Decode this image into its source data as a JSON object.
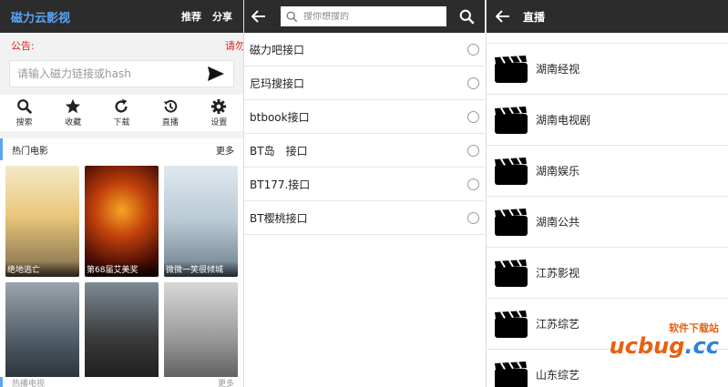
{
  "left": {
    "app_title": "磁力云影视",
    "actions": [
      "推荐",
      "分享"
    ],
    "notice_label": "公告:",
    "notice_text": "请勿",
    "magnet_placeholder": "请输入磁力链接或hash",
    "quick": [
      {
        "label": "搜索",
        "icon": "search-icon"
      },
      {
        "label": "收藏",
        "icon": "star-icon"
      },
      {
        "label": "下载",
        "icon": "refresh-icon"
      },
      {
        "label": "直播",
        "icon": "history-icon"
      },
      {
        "label": "设置",
        "icon": "gear-icon"
      }
    ],
    "hot_title": "热门电影",
    "more": "更多",
    "posters": [
      {
        "caption": "绝地逃亡"
      },
      {
        "caption": "第68届艾美奖"
      },
      {
        "caption": "微微一笑很倾城"
      },
      {
        "caption": ""
      },
      {
        "caption": ""
      },
      {
        "caption": ""
      }
    ],
    "next_section": "热播电视",
    "next_more": "更多"
  },
  "middle": {
    "search_placeholder": "搜你想搜的",
    "apis": [
      "磁力吧接口",
      "尼玛搜接口",
      "btbook接口",
      "BT岛　接口",
      "BT177.接口",
      "BT樱桃接口"
    ]
  },
  "right": {
    "title": "直播",
    "channels": [
      "湖南经视",
      "湖南电视剧",
      "湖南娱乐",
      "湖南公共",
      "江苏影视",
      "江苏综艺",
      "山东综艺"
    ],
    "watermark_cn": "软件下载站",
    "watermark_brand_a": "ucbug",
    "watermark_brand_b": ".cc"
  },
  "colors": {
    "accent": "#5ba4f5",
    "topbar": "#2c2c2c",
    "notice": "#e02020",
    "watermark": "#e8610e"
  }
}
